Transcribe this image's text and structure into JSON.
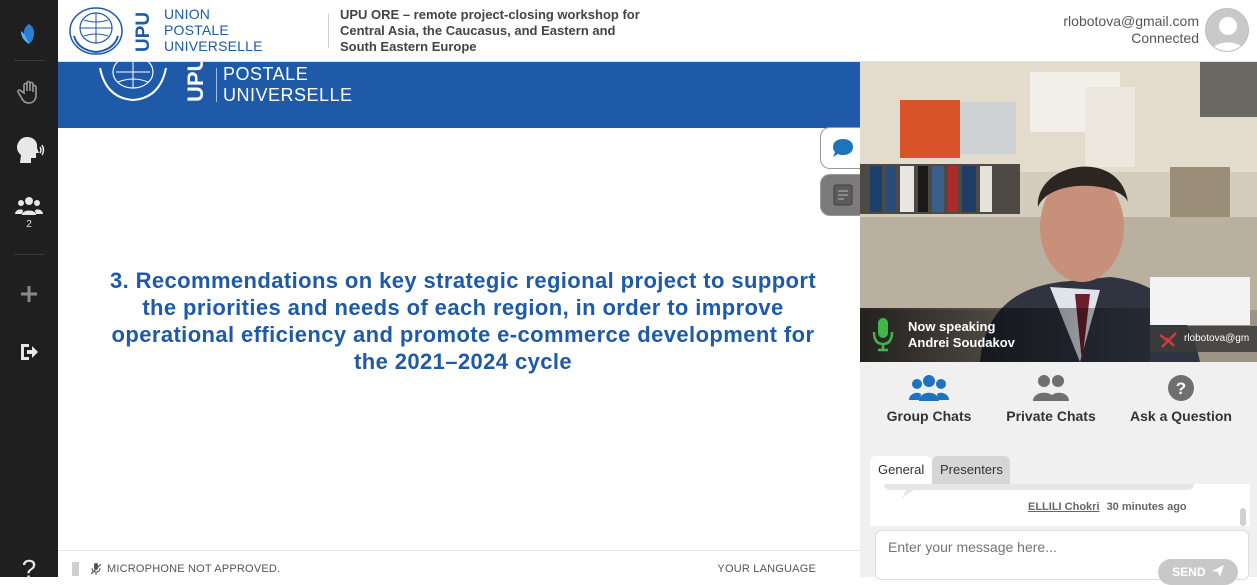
{
  "header": {
    "logo_lines": [
      "UNION",
      "POSTALE",
      "UNIVERSELLE"
    ],
    "logo_abbr": "UPU",
    "event_title": "UPU ORE – remote project-closing workshop for Central Asia, the Caucasus, and Eastern and South Eastern Europe",
    "user_email": "rlobotova@gmail.com",
    "user_status": "Connected"
  },
  "rail": {
    "items": [
      {
        "name": "app-logo-icon"
      },
      {
        "name": "raise-hand-icon"
      },
      {
        "name": "speaker-icon"
      },
      {
        "name": "participants-icon",
        "count": "2"
      },
      {
        "name": "add-icon"
      },
      {
        "name": "exit-icon"
      }
    ],
    "bottom_glyph": "?"
  },
  "slide": {
    "banner_lines": [
      "POSTALE",
      "UNIVERSELLE"
    ],
    "banner_abbr": "UPU",
    "body": "3. Recommendations on key strategic regional project to support the priorities and needs of each region, in order to improve operational efficiency and promote e-commerce development for the 2021–2024 cycle"
  },
  "bottombar": {
    "mic_warning": "MICROPHONE NOT APPROVED.",
    "language": "YOUR LANGUAGE"
  },
  "video": {
    "speaking_label": "Now speaking",
    "speaker_name": "Andrei Soudakov",
    "self_label": "rlobotova@gm"
  },
  "chat": {
    "modes": [
      {
        "label": "Group Chats",
        "icon": "group-icon"
      },
      {
        "label": "Private Chats",
        "icon": "private-chat-icon"
      },
      {
        "label": "Ask a Question",
        "icon": "question-icon"
      }
    ],
    "tabs": [
      "General",
      "Presenters"
    ],
    "last_message": {
      "author": "ELLILI Chokri",
      "time": "30 minutes ago"
    },
    "input_placeholder": "Enter your message here...",
    "send_label": "SEND"
  },
  "colors": {
    "brand_blue": "#1e5aa8",
    "rail_bg": "#1f1f1f",
    "mic_green": "#3fb54a"
  }
}
